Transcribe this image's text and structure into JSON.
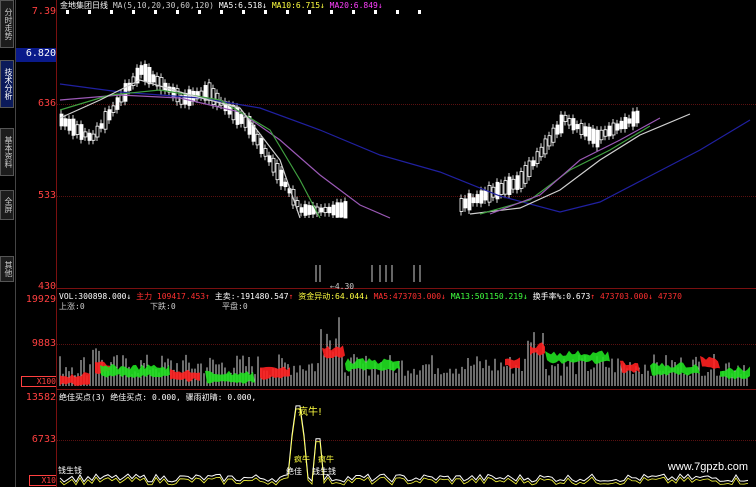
{
  "left_tabs": [
    {
      "label": "分时走势",
      "active": false
    },
    {
      "label": "技术分析",
      "active": true
    },
    {
      "label": "基本资料",
      "active": false
    },
    {
      "label": "全屏",
      "active": false
    },
    {
      "label": "其他",
      "active": false
    }
  ],
  "price_panel": {
    "top_value": "7.39",
    "current_price": "6.820",
    "axis_labels": [
      "636",
      "533",
      "430"
    ],
    "low_marker": "4.30",
    "title": "金地集团日线",
    "ma_params": "MA(5,10,20,30,60,120)",
    "ma5_label": "MA5:",
    "ma5_value": "6.518",
    "ma10_label": "MA10:",
    "ma10_value": "6.715",
    "ma20_label": "MA20:",
    "ma20_value": "6.849"
  },
  "volume_panel": {
    "axis_labels": [
      "19929",
      "9883"
    ],
    "unit": "X100",
    "vol_label": "VOL",
    "vol_value": "300898.000",
    "zhuli_label": "主力",
    "zhuli_value": "109417.453",
    "zhumai_label": "主卖:",
    "zhumai_value": "-191480.547",
    "zijin_label": "资金异动:",
    "zijin_value": "64.044",
    "ma5_label": "MA5:",
    "ma5_value": "473703.000",
    "ma13_label": "MA13:",
    "ma13_value": "501150.219",
    "huanshou_label": "换手率%:",
    "huanshou_value": "0.673",
    "extra_value": "473703.000",
    "extra_value2": "47370",
    "shangzhang_label": "上涨:0",
    "xiadie_label": "下跌:0",
    "pingpan_label": "平盘:0"
  },
  "indicator_panel": {
    "axis_labels": [
      "13582",
      "6733"
    ],
    "unit": "X10",
    "title": "绝佳买点(3)",
    "buy_label": "绝佳买点:",
    "buy_value": "0.000",
    "rain_label": "骤雨初晴:",
    "rain_value": "0.000",
    "annotations": [
      "疯牛!",
      "疯牛",
      "疯牛",
      "疯牛",
      "绝佳",
      "绝佳",
      "钱生钱",
      "钱生钱"
    ]
  },
  "watermark": "www.7gpzb.com",
  "colors": {
    "axis": "#ff4040",
    "grid": "#5a1010",
    "ma_blue": "#2020a0",
    "up": "#ff2020",
    "down": "#20e020",
    "vol_bar": "#d9d9d9",
    "label_yellow": "#ffff40"
  }
}
